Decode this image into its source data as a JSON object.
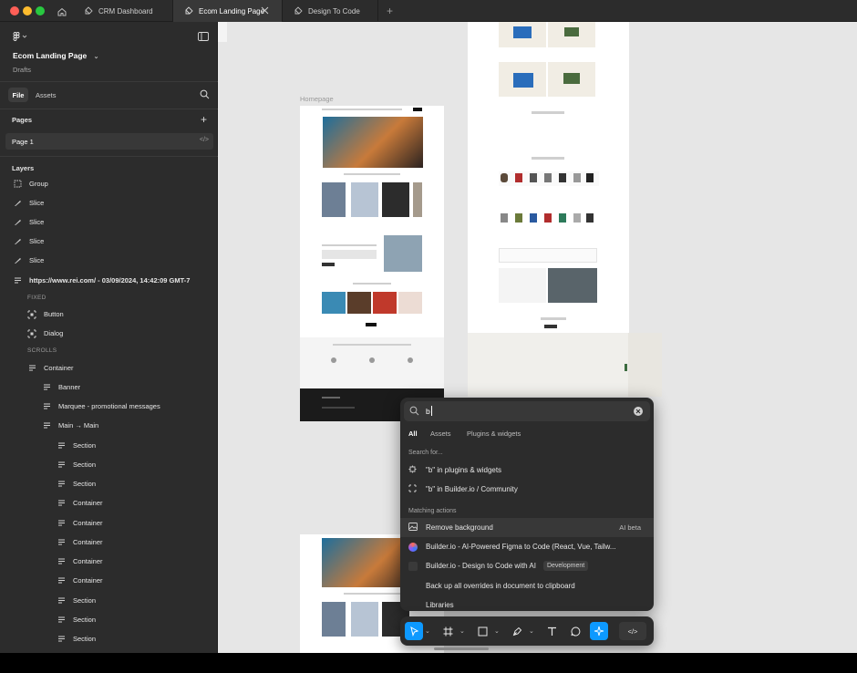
{
  "tabs": [
    {
      "label": "CRM Dashboard"
    },
    {
      "label": "Ecom Landing Page"
    },
    {
      "label": "Design To Code"
    }
  ],
  "sidebar": {
    "file_name": "Ecom Landing Page",
    "location": "Drafts",
    "file_tab": "File",
    "assets_tab": "Assets",
    "pages_title": "Pages",
    "page_1": "Page 1",
    "layers_title": "Layers",
    "layers": [
      {
        "label": "Group",
        "icon": "frame-icon"
      },
      {
        "label": "Slice",
        "icon": "slice-icon"
      },
      {
        "label": "Slice",
        "icon": "slice-icon"
      },
      {
        "label": "Slice",
        "icon": "slice-icon"
      },
      {
        "label": "Slice",
        "icon": "slice-icon"
      },
      {
        "label": "https://www.rei.com/ - 03/09/2024, 14:42:09 GMT-7",
        "icon": "stack-icon"
      }
    ],
    "fixed_label": "FIXED",
    "fixed_items": [
      {
        "label": "Button",
        "icon": "component-icon"
      },
      {
        "label": "Dialog",
        "icon": "component-icon"
      }
    ],
    "scrolls_label": "SCROLLS",
    "scroll_items": [
      {
        "label": "Container"
      },
      {
        "label": "Banner"
      },
      {
        "label": "Marquee - promotional messages"
      },
      {
        "label": "Main → Main"
      },
      {
        "label": "Section"
      },
      {
        "label": "Section"
      },
      {
        "label": "Section"
      },
      {
        "label": "Container"
      },
      {
        "label": "Container"
      },
      {
        "label": "Container"
      },
      {
        "label": "Container"
      },
      {
        "label": "Container"
      },
      {
        "label": "Section"
      },
      {
        "label": "Section"
      },
      {
        "label": "Section"
      }
    ]
  },
  "canvas": {
    "frame_label": "Homepage"
  },
  "palette": {
    "query": "b",
    "filters": [
      "All",
      "Assets",
      "Plugins & widgets"
    ],
    "search_for_title": "Search for...",
    "search_items": [
      {
        "label": "\"b\" in plugins & widgets"
      },
      {
        "label": "\"b\" in Builder.io / Community"
      }
    ],
    "matching_title": "Matching actions",
    "actions": [
      {
        "label": "Remove background",
        "badge": "AI beta"
      },
      {
        "label": "Builder.io - AI-Powered Figma to Code (React, Vue, Tailw...",
        "badge": ""
      },
      {
        "label": "Builder.io - Design to Code with AI",
        "badge": "Development"
      },
      {
        "label": "Back up all overrides in document to clipboard",
        "badge": ""
      },
      {
        "label": "Libraries",
        "badge": ""
      }
    ]
  },
  "colors": {
    "accent": "#0d99ff",
    "panel": "#2c2c2c",
    "canvas": "#e6e6e6"
  }
}
